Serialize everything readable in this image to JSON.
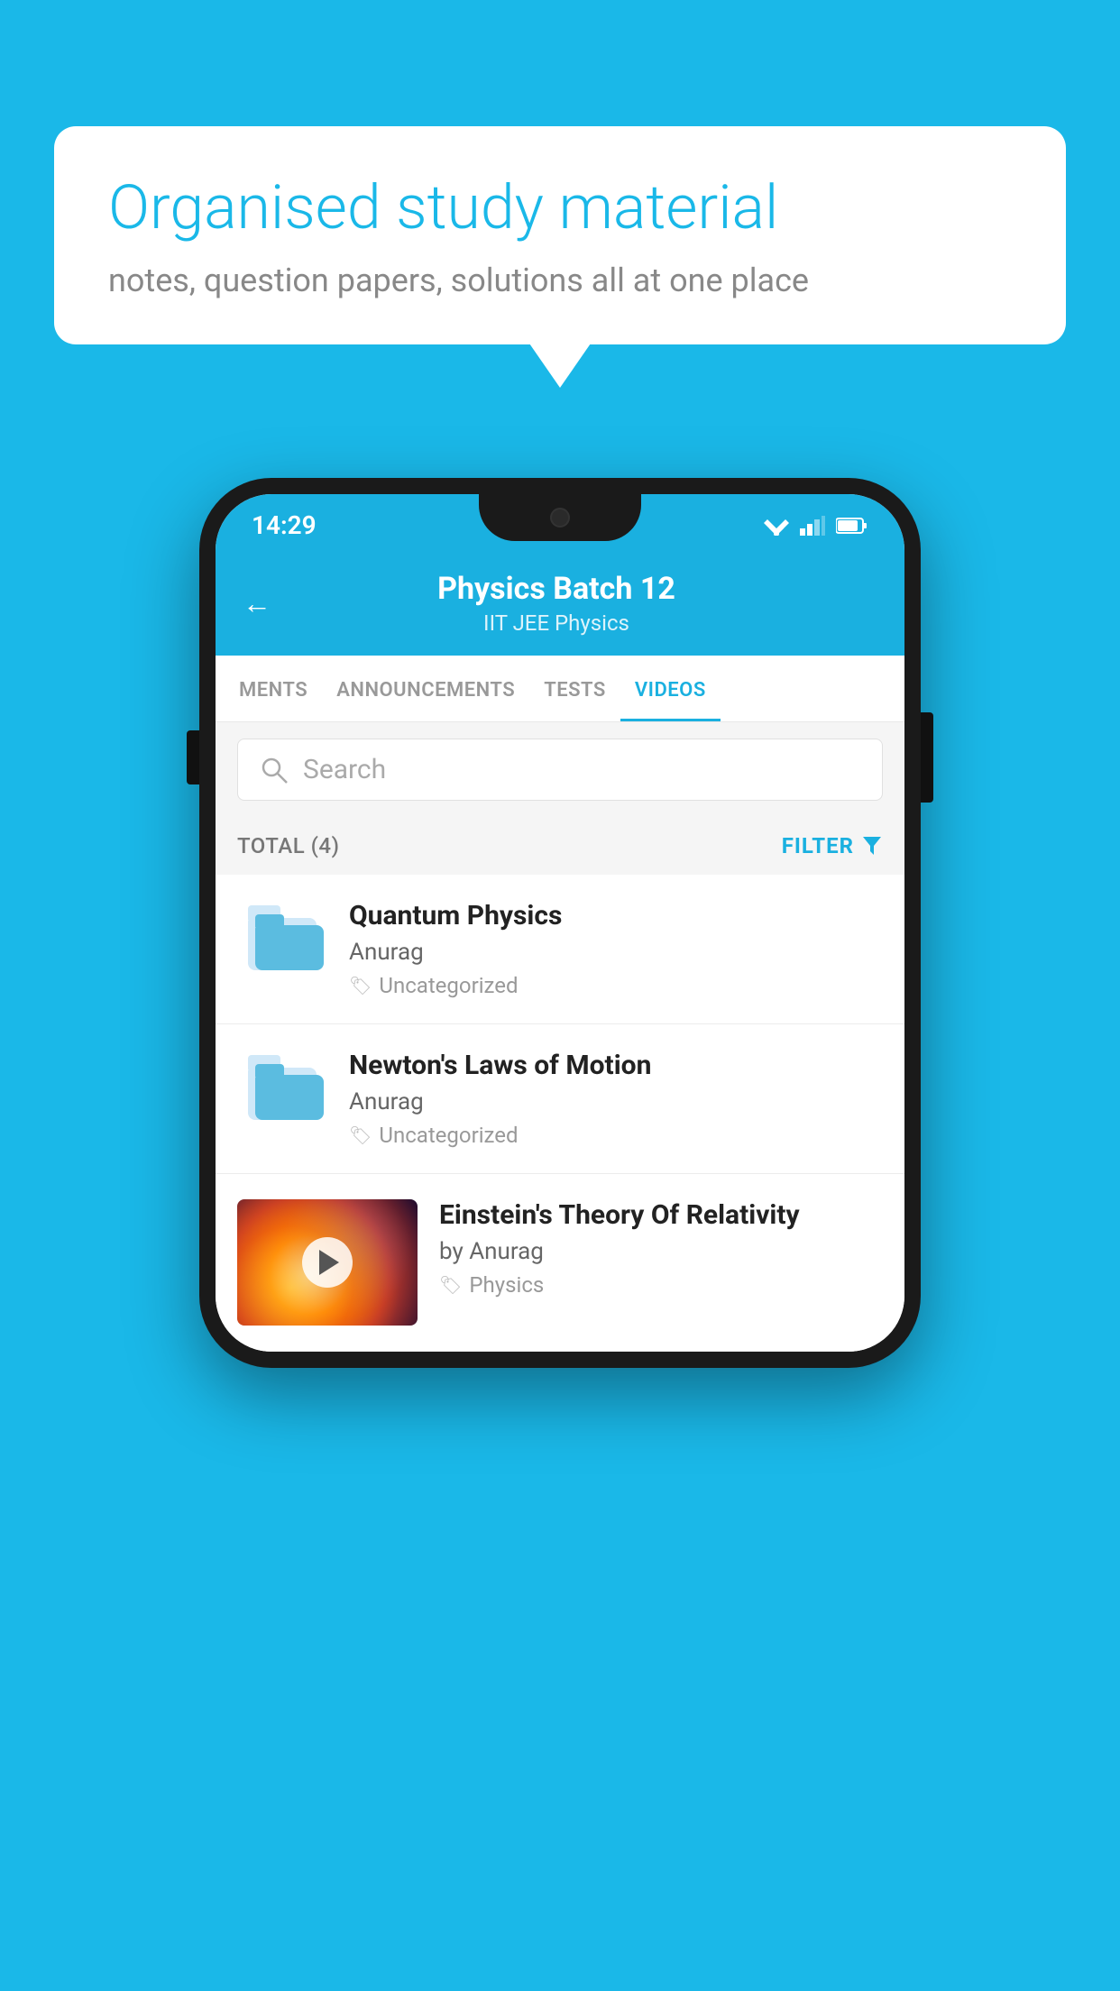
{
  "background_color": "#1ab8e8",
  "bubble": {
    "title": "Organised study material",
    "subtitle": "notes, question papers, solutions all at one place"
  },
  "status_bar": {
    "time": "14:29"
  },
  "header": {
    "title": "Physics Batch 12",
    "subtitle": "IIT JEE   Physics",
    "back_label": "←"
  },
  "tabs": [
    {
      "label": "MENTS",
      "active": false
    },
    {
      "label": "ANNOUNCEMENTS",
      "active": false
    },
    {
      "label": "TESTS",
      "active": false
    },
    {
      "label": "VIDEOS",
      "active": true
    }
  ],
  "search": {
    "placeholder": "Search"
  },
  "filter": {
    "total_label": "TOTAL (4)",
    "filter_label": "FILTER"
  },
  "videos": [
    {
      "title": "Quantum Physics",
      "author": "Anurag",
      "tag": "Uncategorized",
      "has_thumb": false
    },
    {
      "title": "Newton's Laws of Motion",
      "author": "Anurag",
      "tag": "Uncategorized",
      "has_thumb": false
    },
    {
      "title": "Einstein's Theory Of Relativity",
      "author": "by Anurag",
      "tag": "Physics",
      "has_thumb": true
    }
  ]
}
